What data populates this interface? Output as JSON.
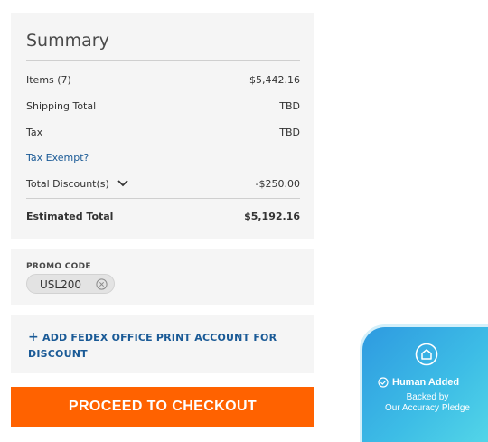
{
  "summary": {
    "title": "Summary",
    "items_label": "Items (7)",
    "items_value": "$5,442.16",
    "shipping_label": "Shipping Total",
    "shipping_value": "TBD",
    "tax_label": "Tax",
    "tax_value": "TBD",
    "tax_exempt_link": "Tax Exempt?",
    "discount_label": "Total Discount(s)",
    "discount_value": "-$250.00",
    "estimated_label": "Estimated Total",
    "estimated_value": "$5,192.16"
  },
  "promo": {
    "label": "PROMO CODE",
    "code": "USL200"
  },
  "fedex": {
    "plus": "+",
    "link_text": "ADD FEDEX OFFICE PRINT ACCOUNT FOR DISCOUNT"
  },
  "checkout": {
    "button_label": "PROCEED TO CHECKOUT"
  },
  "badge": {
    "status": "Human Added",
    "line1": "Backed by",
    "line2": "Our Accuracy Pledge"
  },
  "colors": {
    "checkout": "#ff6200",
    "link": "#1a5a96",
    "panel": "#f5f5f5",
    "badge_start": "#2e9ae0",
    "badge_end": "#56d9e8"
  },
  "icons": {
    "discount_toggle": "chevron-down-icon",
    "promo_remove": "close-circle-icon",
    "badge_logo": "house-circle-icon",
    "badge_check": "check-circle-icon"
  }
}
